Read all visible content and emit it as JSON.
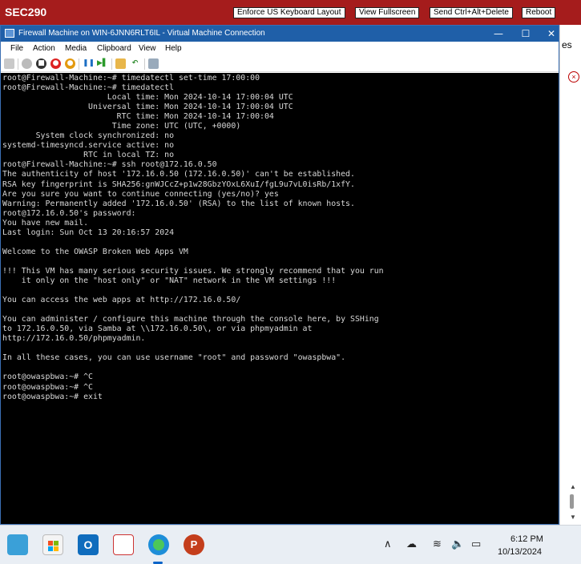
{
  "topbar": {
    "title": "SEC290",
    "buttons": [
      "Enforce US Keyboard Layout",
      "View Fullscreen",
      "Send Ctrl+Alt+Delete",
      "Reboot"
    ],
    "bg_color": "#a51c1c"
  },
  "host_window": {
    "partial_text": "es"
  },
  "vm_window": {
    "title": "Firewall Machine on WIN-6JNN6RLT6IL - Virtual Machine Connection",
    "menu": [
      "File",
      "Action",
      "Media",
      "Clipboard",
      "View",
      "Help"
    ],
    "controls": {
      "minimize": "—",
      "maximize": "☐",
      "close": "✕"
    },
    "toolbar_icons": [
      "ctrl-alt-del-icon",
      "start-icon",
      "turn-off-icon",
      "shutdown-icon",
      "save-icon",
      "pause-icon",
      "reset-icon",
      "checkpoint-icon",
      "revert-icon",
      "enhanced-session-icon"
    ]
  },
  "console": {
    "lines": [
      "root@Firewall-Machine:~# timedatectl set-time 17:00:00",
      "root@Firewall-Machine:~# timedatectl",
      "                      Local time: Mon 2024-10-14 17:00:04 UTC",
      "                  Universal time: Mon 2024-10-14 17:00:04 UTC",
      "                        RTC time: Mon 2024-10-14 17:00:04",
      "                       Time zone: UTC (UTC, +0000)",
      "       System clock synchronized: no",
      "systemd-timesyncd.service active: no",
      "                 RTC in local TZ: no",
      "root@Firewall-Machine:~# ssh root@172.16.0.50",
      "The authenticity of host '172.16.0.50 (172.16.0.50)' can't be established.",
      "RSA key fingerprint is SHA256:gnWJCcZ+p1w28GbzYOxL6XuI/fgL9u7vL0isRb/1xfY.",
      "Are you sure you want to continue connecting (yes/no)? yes",
      "Warning: Permanently added '172.16.0.50' (RSA) to the list of known hosts.",
      "root@172.16.0.50's password:",
      "You have new mail.",
      "Last login: Sun Oct 13 20:16:57 2024",
      "",
      "Welcome to the OWASP Broken Web Apps VM",
      "",
      "!!! This VM has many serious security issues. We strongly recommend that you run",
      "    it only on the \"host only\" or \"NAT\" network in the VM settings !!!",
      "",
      "You can access the web apps at http://172.16.0.50/",
      "",
      "You can administer / configure this machine through the console here, by SSHing",
      "to 172.16.0.50, via Samba at \\\\172.16.0.50\\, or via phpmyadmin at",
      "http://172.16.0.50/phpmyadmin.",
      "",
      "In all these cases, you can use username \"root\" and password \"owaspbwa\".",
      "",
      "root@owaspbwa:~# ^C",
      "root@owaspbwa:~# ^C",
      "root@owaspbwa:~# exit"
    ]
  },
  "taskbar": {
    "apps": [
      "notepad-icon",
      "microsoft-store-icon",
      "outlook-icon",
      "snipping-tool-icon",
      "edge-icon",
      "powerpoint-icon"
    ],
    "active_app": "edge-icon",
    "tray_icons": [
      "chevron-up-icon",
      "cloud-sync-icon",
      "wifi-icon",
      "volume-icon",
      "battery-icon"
    ],
    "time": "6:12 PM",
    "date": "10/13/2024"
  }
}
